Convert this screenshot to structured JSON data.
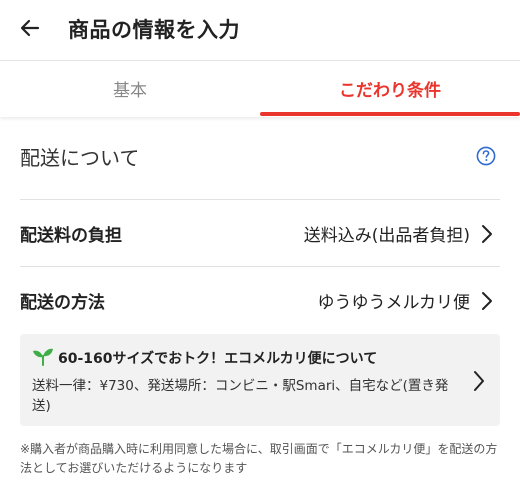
{
  "header": {
    "title": "商品の情報を入力",
    "back_icon": "arrow-left-icon"
  },
  "tabs": [
    {
      "label": "基本",
      "selected": false
    },
    {
      "label": "こだわり条件",
      "selected": true
    }
  ],
  "colors": {
    "accent": "#ea352d",
    "help_icon": "#2f6bd1",
    "sprout": "#3fae49"
  },
  "section": {
    "title": "配送について",
    "help_icon": "question-circle-icon"
  },
  "rows": [
    {
      "label": "配送料の負担",
      "value": "送料込み(出品者負担)"
    },
    {
      "label": "配送の方法",
      "value": "ゆうゆうメルカリ便"
    }
  ],
  "eco_banner": {
    "icon": "sprout-icon",
    "title": "60-160サイズでおトク！エコメルカリ便について",
    "description": "送料一律：¥730、発送場所：コンビニ・駅Smari、自宅など(置き発送)"
  },
  "note": "※購入者が商品購入時に利用同意した場合に、取引画面で「エコメルカリ便」を配送の方法としてお選びいただけるようになります"
}
